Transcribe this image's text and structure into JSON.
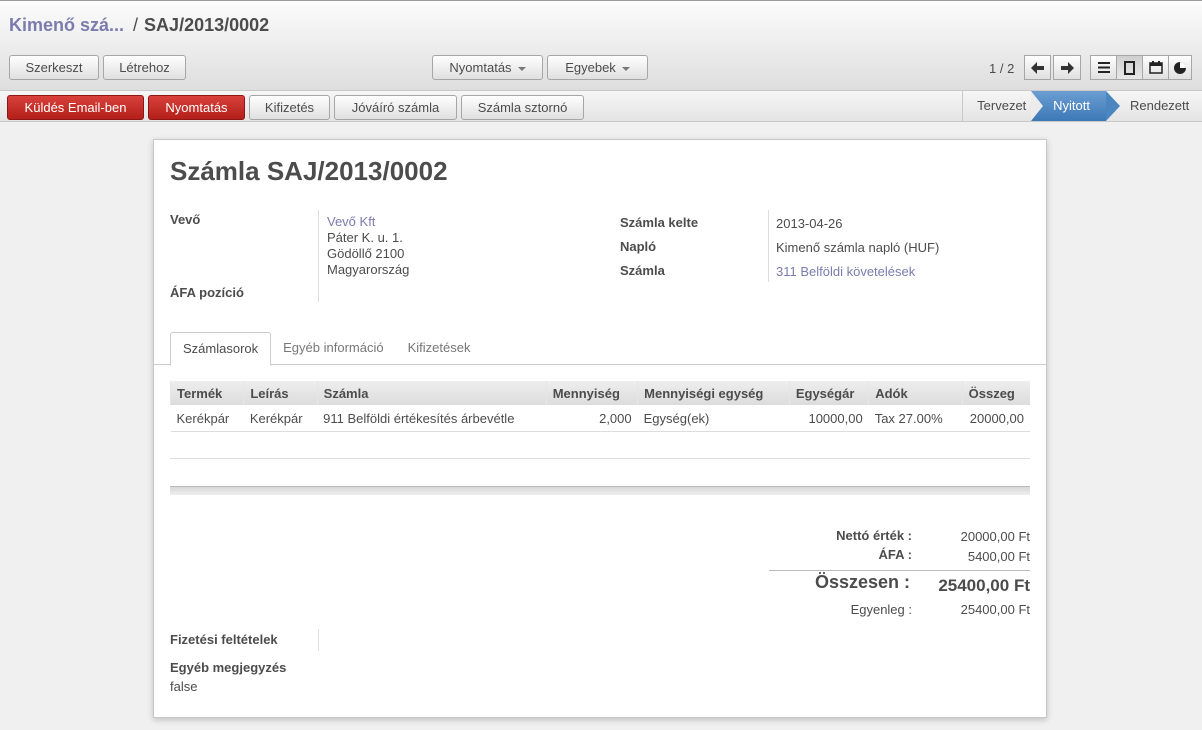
{
  "breadcrumb": {
    "parent": "Kimenő szá...",
    "separator": "/",
    "current": "SAJ/2013/0002"
  },
  "toolbar": {
    "edit": "Szerkeszt",
    "create": "Létrehoz",
    "print": "Nyomtatás",
    "more": "Egyebek"
  },
  "pager": {
    "text": "1 / 2"
  },
  "actions": {
    "send_email": "Küldés Email-ben",
    "print": "Nyomtatás",
    "payment": "Kifizetés",
    "credit_note": "Jóváíró számla",
    "cancel": "Számla sztornó"
  },
  "statusbar": {
    "steps": [
      "Tervezet",
      "Nyitott",
      "Rendezett"
    ],
    "active": "Nyitott"
  },
  "form": {
    "title": "Számla SAJ/2013/0002",
    "customer_label": "Vevő",
    "customer_name": "Vevő Kft",
    "customer_address1": "Páter K. u. 1.",
    "customer_address2": "Gödöllő 2100",
    "customer_address3": "Magyarország",
    "fiscal_position_label": "ÁFA pozíció",
    "date_label": "Számla kelte",
    "date_value": "2013-04-26",
    "journal_label": "Napló",
    "journal_value": "Kimenő számla napló (HUF)",
    "account_label": "Számla",
    "account_value": "311 Belföldi követelések"
  },
  "tabs": [
    "Számlasorok",
    "Egyéb információ",
    "Kifizetések"
  ],
  "table": {
    "headers": [
      "Termék",
      "Leírás",
      "Számla",
      "Mennyiség",
      "Mennyiségi egység",
      "Egységár",
      "Adók",
      "Összeg"
    ],
    "rows": [
      [
        "Kerékpár",
        "Kerékpár",
        "911 Belföldi értékesítés árbevétle",
        "2,000",
        "Egység(ek)",
        "10000,00",
        "Tax 27.00%",
        "20000,00"
      ]
    ]
  },
  "totals": {
    "net_label": "Nettó érték :",
    "net_value": "20000,00 Ft",
    "vat_label": "ÁFA :",
    "vat_value": "5400,00 Ft",
    "total_label": "Összesen :",
    "total_value": "25400,00 Ft",
    "balance_label": "Egyenleg :",
    "balance_value": "25400,00 Ft"
  },
  "footer": {
    "payment_terms_label": "Fizetési feltételek",
    "other_note_label": "Egyéb megjegyzés",
    "other_note_value": "false"
  },
  "colors": {
    "accent_red": "#c0282a",
    "step_active": "#4b86c1",
    "link": "#7c7bad"
  },
  "icons": {
    "prev": "arrow-left-icon",
    "next": "arrow-right-icon",
    "list_view": "list-icon",
    "form_view": "form-icon",
    "calendar_view": "calendar-icon",
    "graph_view": "graph-icon"
  }
}
